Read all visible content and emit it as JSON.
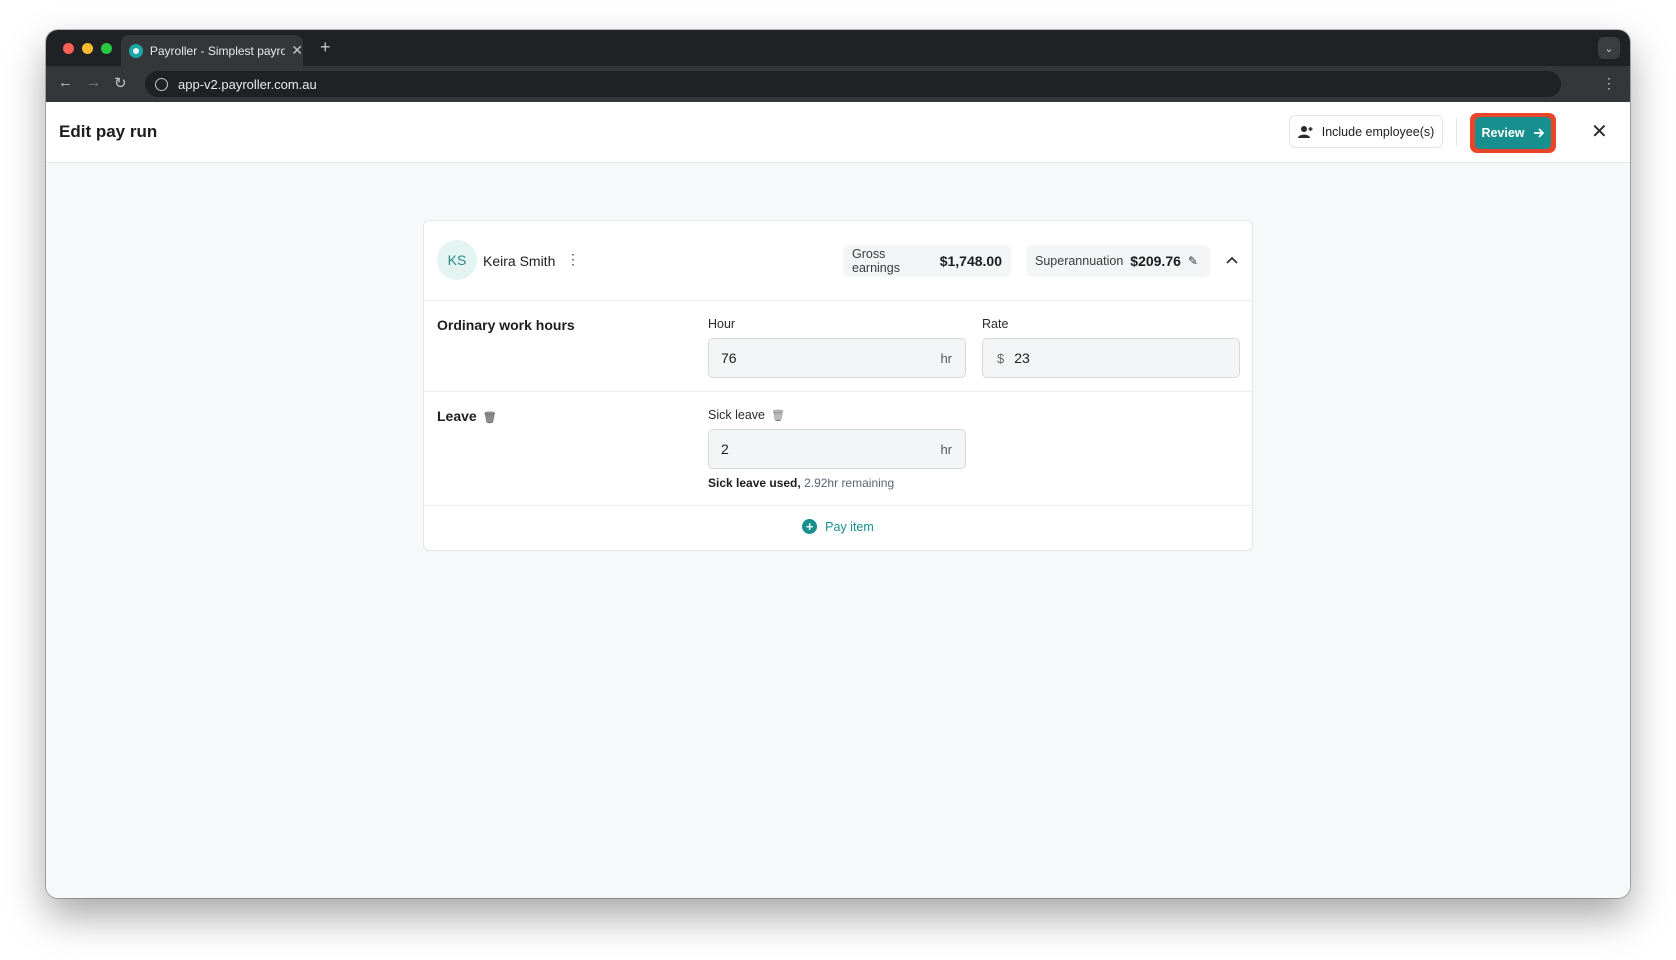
{
  "browser": {
    "tab_title": "Payroller - Simplest payroll so",
    "tab_close": "✕",
    "new_tab": "+",
    "url": "app-v2.payroller.com.au"
  },
  "header": {
    "title": "Edit pay run",
    "include_label": "Include employee(s)",
    "review_label": "Review"
  },
  "employee": {
    "initials": "KS",
    "name": "Keira Smith",
    "gross_label": "Gross earnings",
    "gross_value": "$1,748.00",
    "super_label": "Superannuation",
    "super_value": "$209.76"
  },
  "ordinary": {
    "title": "Ordinary work hours",
    "hour_label": "Hour",
    "hour_value": "76",
    "hour_unit": "hr",
    "rate_label": "Rate",
    "rate_prefix": "$",
    "rate_value": "23"
  },
  "leave": {
    "title": "Leave",
    "sick_label": "Sick leave",
    "sick_value": "2",
    "sick_unit": "hr",
    "used_text": "Sick leave used,",
    "remaining_text": "2.92hr remaining"
  },
  "pay_item_label": "Pay item",
  "colors": {
    "accent": "#178f8f",
    "highlight": "#e8452a"
  }
}
